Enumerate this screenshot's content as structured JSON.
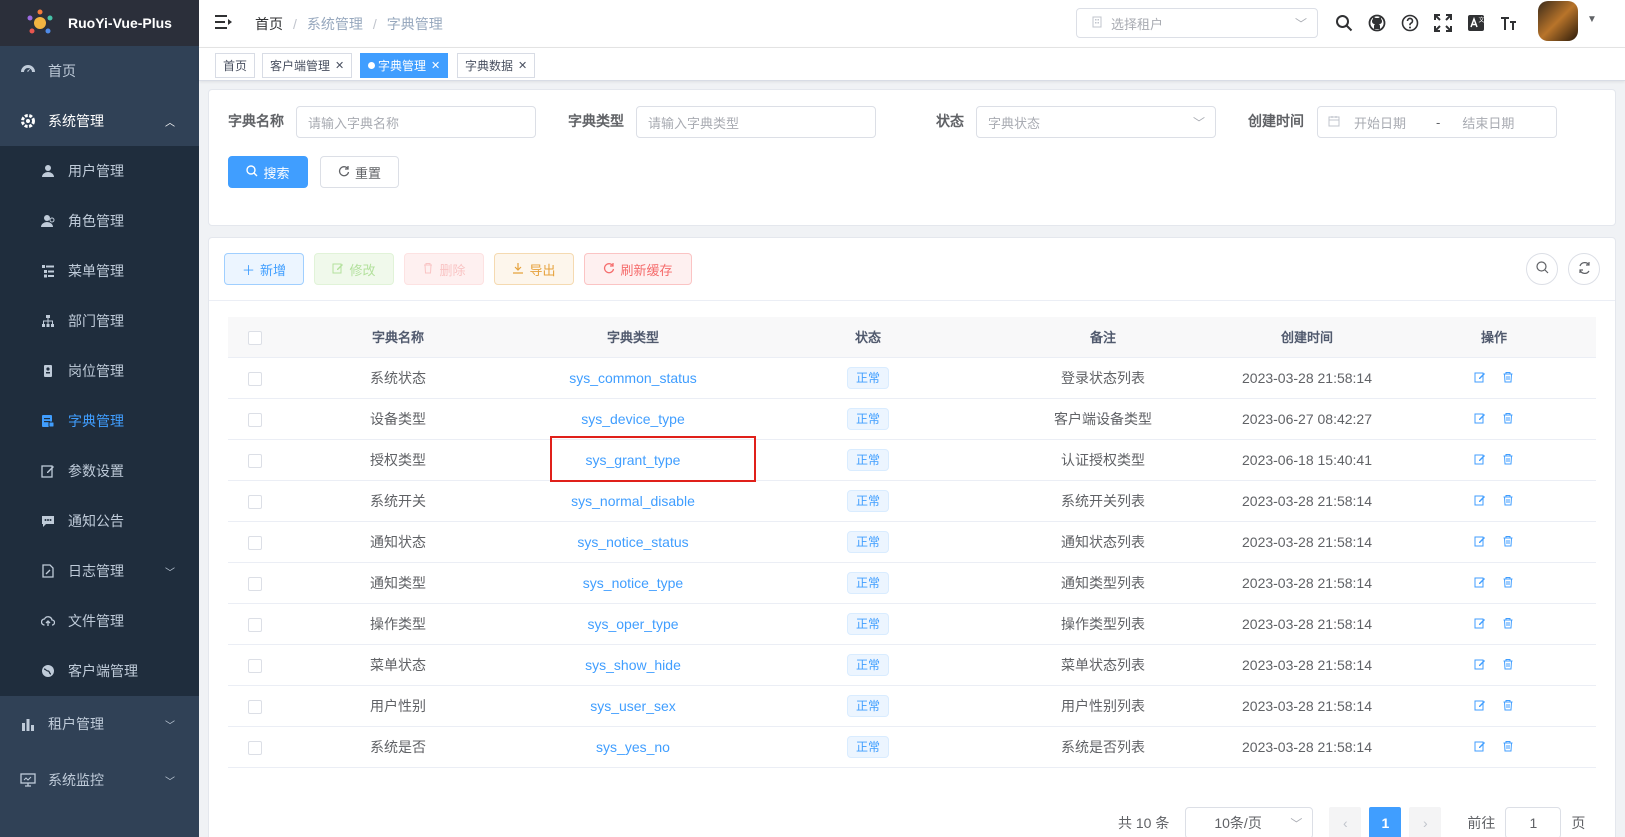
{
  "app": {
    "title": "RuoYi-Vue-Plus"
  },
  "sidebar": {
    "items": [
      {
        "label": "首页",
        "icon": "dashboard-icon"
      },
      {
        "label": "系统管理",
        "icon": "gear-icon",
        "expanded": true
      },
      {
        "label": "租户管理",
        "icon": "chart-icon"
      },
      {
        "label": "系统监控",
        "icon": "monitor-icon"
      }
    ],
    "sub_items": [
      {
        "label": "用户管理",
        "icon": "user-icon"
      },
      {
        "label": "角色管理",
        "icon": "role-icon"
      },
      {
        "label": "菜单管理",
        "icon": "tree-table-icon"
      },
      {
        "label": "部门管理",
        "icon": "tree-icon"
      },
      {
        "label": "岗位管理",
        "icon": "post-icon"
      },
      {
        "label": "字典管理",
        "icon": "dict-icon",
        "active": true
      },
      {
        "label": "参数设置",
        "icon": "edit-icon"
      },
      {
        "label": "通知公告",
        "icon": "message-icon"
      },
      {
        "label": "日志管理",
        "icon": "log-icon",
        "has_children": true
      },
      {
        "label": "文件管理",
        "icon": "upload-icon"
      },
      {
        "label": "客户端管理",
        "icon": "international-icon"
      }
    ]
  },
  "header": {
    "breadcrumb": [
      "首页",
      "系统管理",
      "字典管理"
    ],
    "tenant_placeholder": "选择租户"
  },
  "tags": [
    {
      "label": "首页"
    },
    {
      "label": "客户端管理"
    },
    {
      "label": "字典管理",
      "active": true
    },
    {
      "label": "字典数据"
    }
  ],
  "search": {
    "dict_name_label": "字典名称",
    "dict_name_placeholder": "请输入字典名称",
    "dict_type_label": "字典类型",
    "dict_type_placeholder": "请输入字典类型",
    "status_label": "状态",
    "status_placeholder": "字典状态",
    "created_label": "创建时间",
    "start_placeholder": "开始日期",
    "range_sep": "-",
    "end_placeholder": "结束日期",
    "search_btn": "搜索",
    "reset_btn": "重置"
  },
  "toolbar": {
    "add": "新增",
    "edit": "修改",
    "delete": "删除",
    "export": "导出",
    "refresh_cache": "刷新缓存"
  },
  "table": {
    "columns": [
      "字典名称",
      "字典类型",
      "状态",
      "备注",
      "创建时间",
      "操作"
    ],
    "rows": [
      {
        "name": "系统状态",
        "type": "sys_common_status",
        "status": "正常",
        "remark": "登录状态列表",
        "created": "2023-03-28 21:58:14"
      },
      {
        "name": "设备类型",
        "type": "sys_device_type",
        "status": "正常",
        "remark": "客户端设备类型",
        "created": "2023-06-27 08:42:27"
      },
      {
        "name": "授权类型",
        "type": "sys_grant_type",
        "status": "正常",
        "remark": "认证授权类型",
        "created": "2023-06-18 15:40:41"
      },
      {
        "name": "系统开关",
        "type": "sys_normal_disable",
        "status": "正常",
        "remark": "系统开关列表",
        "created": "2023-03-28 21:58:14"
      },
      {
        "name": "通知状态",
        "type": "sys_notice_status",
        "status": "正常",
        "remark": "通知状态列表",
        "created": "2023-03-28 21:58:14"
      },
      {
        "name": "通知类型",
        "type": "sys_notice_type",
        "status": "正常",
        "remark": "通知类型列表",
        "created": "2023-03-28 21:58:14"
      },
      {
        "name": "操作类型",
        "type": "sys_oper_type",
        "status": "正常",
        "remark": "操作类型列表",
        "created": "2023-03-28 21:58:14"
      },
      {
        "name": "菜单状态",
        "type": "sys_show_hide",
        "status": "正常",
        "remark": "菜单状态列表",
        "created": "2023-03-28 21:58:14"
      },
      {
        "name": "用户性别",
        "type": "sys_user_sex",
        "status": "正常",
        "remark": "用户性别列表",
        "created": "2023-03-28 21:58:14"
      },
      {
        "name": "系统是否",
        "type": "sys_yes_no",
        "status": "正常",
        "remark": "系统是否列表",
        "created": "2023-03-28 21:58:14"
      }
    ]
  },
  "pagination": {
    "total": "共 10 条",
    "page_size": "10条/页",
    "current": "1",
    "goto_label": "前往",
    "goto_value": "1",
    "page_suffix": "页"
  },
  "colors": {
    "primary": "#409eff",
    "sidebar_bg": "#304156",
    "highlight": "#e0201a"
  }
}
